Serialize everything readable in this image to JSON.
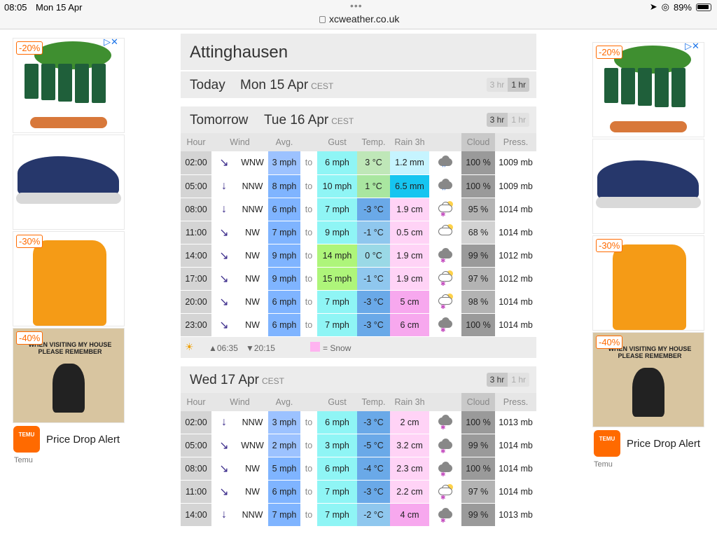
{
  "status": {
    "time": "08:05",
    "date": "Mon 15 Apr",
    "url": "xcweather.co.uk",
    "battery": "89%"
  },
  "ads_left": {
    "badges": [
      "-20%",
      "-30%",
      "-40%"
    ],
    "sign_title": "WHEN VISITING MY HOUSE PLEASE REMEMBER",
    "advertiser_title": "Price Drop Alert",
    "advertiser_sub": "Temu",
    "logo_text": "TEMU"
  },
  "ads_right": {
    "badges": [
      "-20%",
      "-30%",
      "-40%"
    ],
    "sign_title": "WHEN VISITING MY HOUSE PLEASE REMEMBER",
    "advertiser_title": "Price Drop Alert",
    "advertiser_sub": "Temu",
    "logo_text": "TEMU"
  },
  "location": "Attinghausen",
  "toggle": {
    "three": "3 hr",
    "one": "1 hr"
  },
  "today": {
    "label": "Today",
    "date": "Mon 15 Apr",
    "tz": "CEST"
  },
  "tomorrow": {
    "label": "Tomorrow",
    "date": "Tue 16 Apr",
    "tz": "CEST"
  },
  "wed": {
    "date": "Wed 17 Apr",
    "tz": "CEST"
  },
  "headers": {
    "hour": "Hour",
    "wind": "Wind",
    "avg": "Avg.",
    "gust": "Gust",
    "temp": "Temp.",
    "rain": "Rain 3h",
    "cloud": "Cloud",
    "press": "Press."
  },
  "to_label": "to",
  "sun": {
    "rise": "▲06:35",
    "set": "▼20:15",
    "snow_key": "= Snow"
  },
  "colors": {
    "avg": "#7fb4ff",
    "gust": "#8ff5f5",
    "snow": "#ffc5f3",
    "cloud": "#a8a8a8"
  },
  "tue_rows": [
    {
      "hour": "02:00",
      "dir": "WNW",
      "avg": "3 mph",
      "gust": "6 mph",
      "temp": "3 °C",
      "rain": "1.2 mm",
      "cloud": "100 %",
      "press": "1009 mb",
      "icon": "cloud-rain-icon"
    },
    {
      "hour": "05:00",
      "dir": "NNW",
      "avg": "8 mph",
      "gust": "10 mph",
      "temp": "1 °C",
      "rain": "6.5 mm",
      "cloud": "100 %",
      "press": "1009 mb",
      "icon": "cloud-rain-icon"
    },
    {
      "hour": "08:00",
      "dir": "NNW",
      "avg": "6 mph",
      "gust": "7 mph",
      "temp": "-3 °C",
      "rain": "1.9 cm",
      "cloud": "95 %",
      "press": "1014 mb",
      "icon": "sun-cloud-snow-icon"
    },
    {
      "hour": "11:00",
      "dir": "NW",
      "avg": "7 mph",
      "gust": "9 mph",
      "temp": "-1 °C",
      "rain": "0.5 cm",
      "cloud": "68 %",
      "press": "1014 mb",
      "icon": "sun-cloud-icon"
    },
    {
      "hour": "14:00",
      "dir": "NW",
      "avg": "9 mph",
      "gust": "14 mph",
      "temp": "0 °C",
      "rain": "1.9 cm",
      "cloud": "99 %",
      "press": "1012 mb",
      "icon": "cloud-snow-icon"
    },
    {
      "hour": "17:00",
      "dir": "NW",
      "avg": "9 mph",
      "gust": "15 mph",
      "temp": "-1 °C",
      "rain": "1.9 cm",
      "cloud": "97 %",
      "press": "1012 mb",
      "icon": "sun-cloud-snow-icon"
    },
    {
      "hour": "20:00",
      "dir": "NW",
      "avg": "6 mph",
      "gust": "7 mph",
      "temp": "-3 °C",
      "rain": "5 cm",
      "cloud": "98 %",
      "press": "1014 mb",
      "icon": "sun-cloud-snow-icon"
    },
    {
      "hour": "23:00",
      "dir": "NW",
      "avg": "6 mph",
      "gust": "7 mph",
      "temp": "-3 °C",
      "rain": "6 cm",
      "cloud": "100 %",
      "press": "1014 mb",
      "icon": "cloud-snow-icon"
    }
  ],
  "wed_rows": [
    {
      "hour": "02:00",
      "dir": "NNW",
      "avg": "3 mph",
      "gust": "6 mph",
      "temp": "-3 °C",
      "rain": "2 cm",
      "cloud": "100 %",
      "press": "1013 mb",
      "icon": "cloud-snow-icon"
    },
    {
      "hour": "05:00",
      "dir": "WNW",
      "avg": "2 mph",
      "gust": "3 mph",
      "temp": "-5 °C",
      "rain": "3.2 cm",
      "cloud": "99 %",
      "press": "1014 mb",
      "icon": "cloud-snow-icon"
    },
    {
      "hour": "08:00",
      "dir": "NW",
      "avg": "5 mph",
      "gust": "6 mph",
      "temp": "-4 °C",
      "rain": "2.3 cm",
      "cloud": "100 %",
      "press": "1014 mb",
      "icon": "cloud-snow-icon"
    },
    {
      "hour": "11:00",
      "dir": "NW",
      "avg": "6 mph",
      "gust": "7 mph",
      "temp": "-3 °C",
      "rain": "2.2 cm",
      "cloud": "97 %",
      "press": "1014 mb",
      "icon": "sun-cloud-snow-icon"
    },
    {
      "hour": "14:00",
      "dir": "NNW",
      "avg": "7 mph",
      "gust": "7 mph",
      "temp": "-2 °C",
      "rain": "4 cm",
      "cloud": "99 %",
      "press": "1013 mb",
      "icon": "cloud-snow-icon"
    }
  ]
}
